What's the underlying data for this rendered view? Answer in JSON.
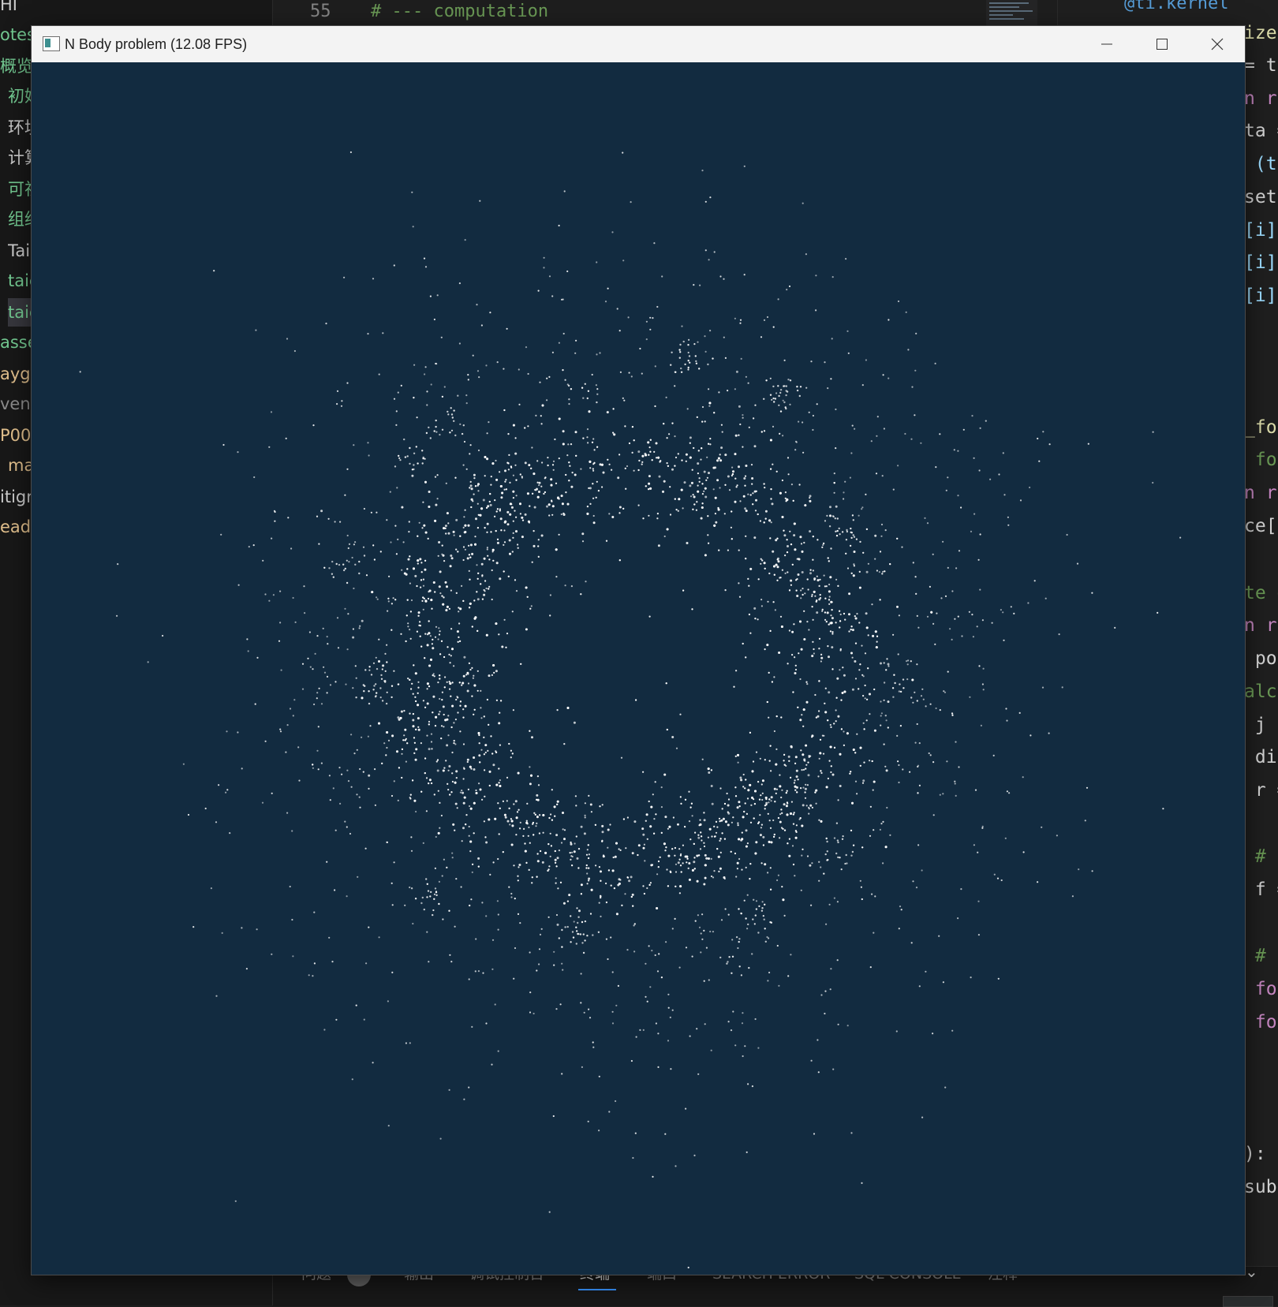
{
  "window": {
    "title": "N Body problem (12.08 FPS)",
    "icon": "app-window-icon",
    "background_color": "#122b40",
    "particle_color": "#ffffff",
    "controls": [
      "minimize-icon",
      "maximize-icon",
      "close-icon"
    ]
  },
  "explorer": {
    "items": [
      {
        "text": "HI",
        "color": "#cccccc"
      },
      {
        "text": "otes",
        "color": "#73c991"
      },
      {
        "text": "概览",
        "color": "#73c991"
      },
      {
        "text": "初始",
        "color": "#73c991"
      },
      {
        "text": "环境",
        "color": "#cccccc"
      },
      {
        "text": "计算",
        "color": "#cccccc"
      },
      {
        "text": "可视",
        "color": "#73c991"
      },
      {
        "text": "组织",
        "color": "#73c991"
      },
      {
        "text": "Tai",
        "color": "#cccccc"
      },
      {
        "text": "taic",
        "color": "#73c991"
      },
      {
        "text": "taic",
        "color": "#73c991"
      },
      {
        "text": "asse",
        "color": "#73c991"
      },
      {
        "text": "ayg",
        "color": "#e2c08d"
      },
      {
        "text": "ven",
        "color": "#8b8b8b"
      },
      {
        "text": "P00",
        "color": "#e2c08d"
      },
      {
        "text": "ma",
        "color": "#e2c08d"
      },
      {
        "text": "itign",
        "color": "#cccccc"
      },
      {
        "text": "eadm",
        "color": "#e2c08d"
      }
    ]
  },
  "editor": {
    "line_number": "55",
    "line_text": "# --- computation",
    "right_top_fragment": "@ti.kernel",
    "right_fragments": [
      {
        "text": "ize(",
        "color": "#dcdcaa"
      },
      {
        "text": "= ti",
        "color": "#d4d4d4"
      },
      {
        "text": "n ra",
        "color": "#c586c0"
      },
      {
        "text": "ta =",
        "color": "#d4d4d4"
      },
      {
        "text": " (ti",
        "color": "#9cdcfe"
      },
      {
        "text": "set ",
        "color": "#d4d4d4"
      },
      {
        "text": "[i] ",
        "color": "#9cdcfe"
      },
      {
        "text": "[i] ",
        "color": "#9cdcfe"
      },
      {
        "text": "[i] ",
        "color": "#9cdcfe"
      },
      {
        "text": "_for",
        "color": "#dcdcaa"
      },
      {
        "text": " for",
        "color": "#6a9955"
      },
      {
        "text": "n ra",
        "color": "#c586c0"
      },
      {
        "text": "ce[i",
        "color": "#d4d4d4"
      },
      {
        "text": "te g",
        "color": "#6a9955"
      },
      {
        "text": "n ra",
        "color": "#c586c0"
      },
      {
        "text": " pos",
        "color": "#d4d4d4"
      },
      {
        "text": "alcu",
        "color": "#6a9955"
      },
      {
        "text": " j i",
        "color": "#d4d4d4"
      },
      {
        "text": " dif",
        "color": "#d4d4d4"
      },
      {
        "text": " r =",
        "color": "#d4d4d4"
      },
      {
        "text": " # c",
        "color": "#6a9955"
      },
      {
        "text": " f =",
        "color": "#d4d4d4"
      },
      {
        "text": " # a",
        "color": "#6a9955"
      },
      {
        "text": " for",
        "color": "#c586c0"
      },
      {
        "text": " for",
        "color": "#c586c0"
      },
      {
        "text": "):",
        "color": "#d4d4d4"
      },
      {
        "text": "subs",
        "color": "#d4d4d4"
      }
    ]
  },
  "panel": {
    "tabs": [
      "问题",
      "输出",
      "调试控制台",
      "终端",
      "端口",
      "SEARCH ERROR",
      "SQL CONSOLE",
      "注释"
    ],
    "active_tab": "终端",
    "badge_icon": "problem-count-badge",
    "chevron_icon": "chevron-down-icon"
  }
}
